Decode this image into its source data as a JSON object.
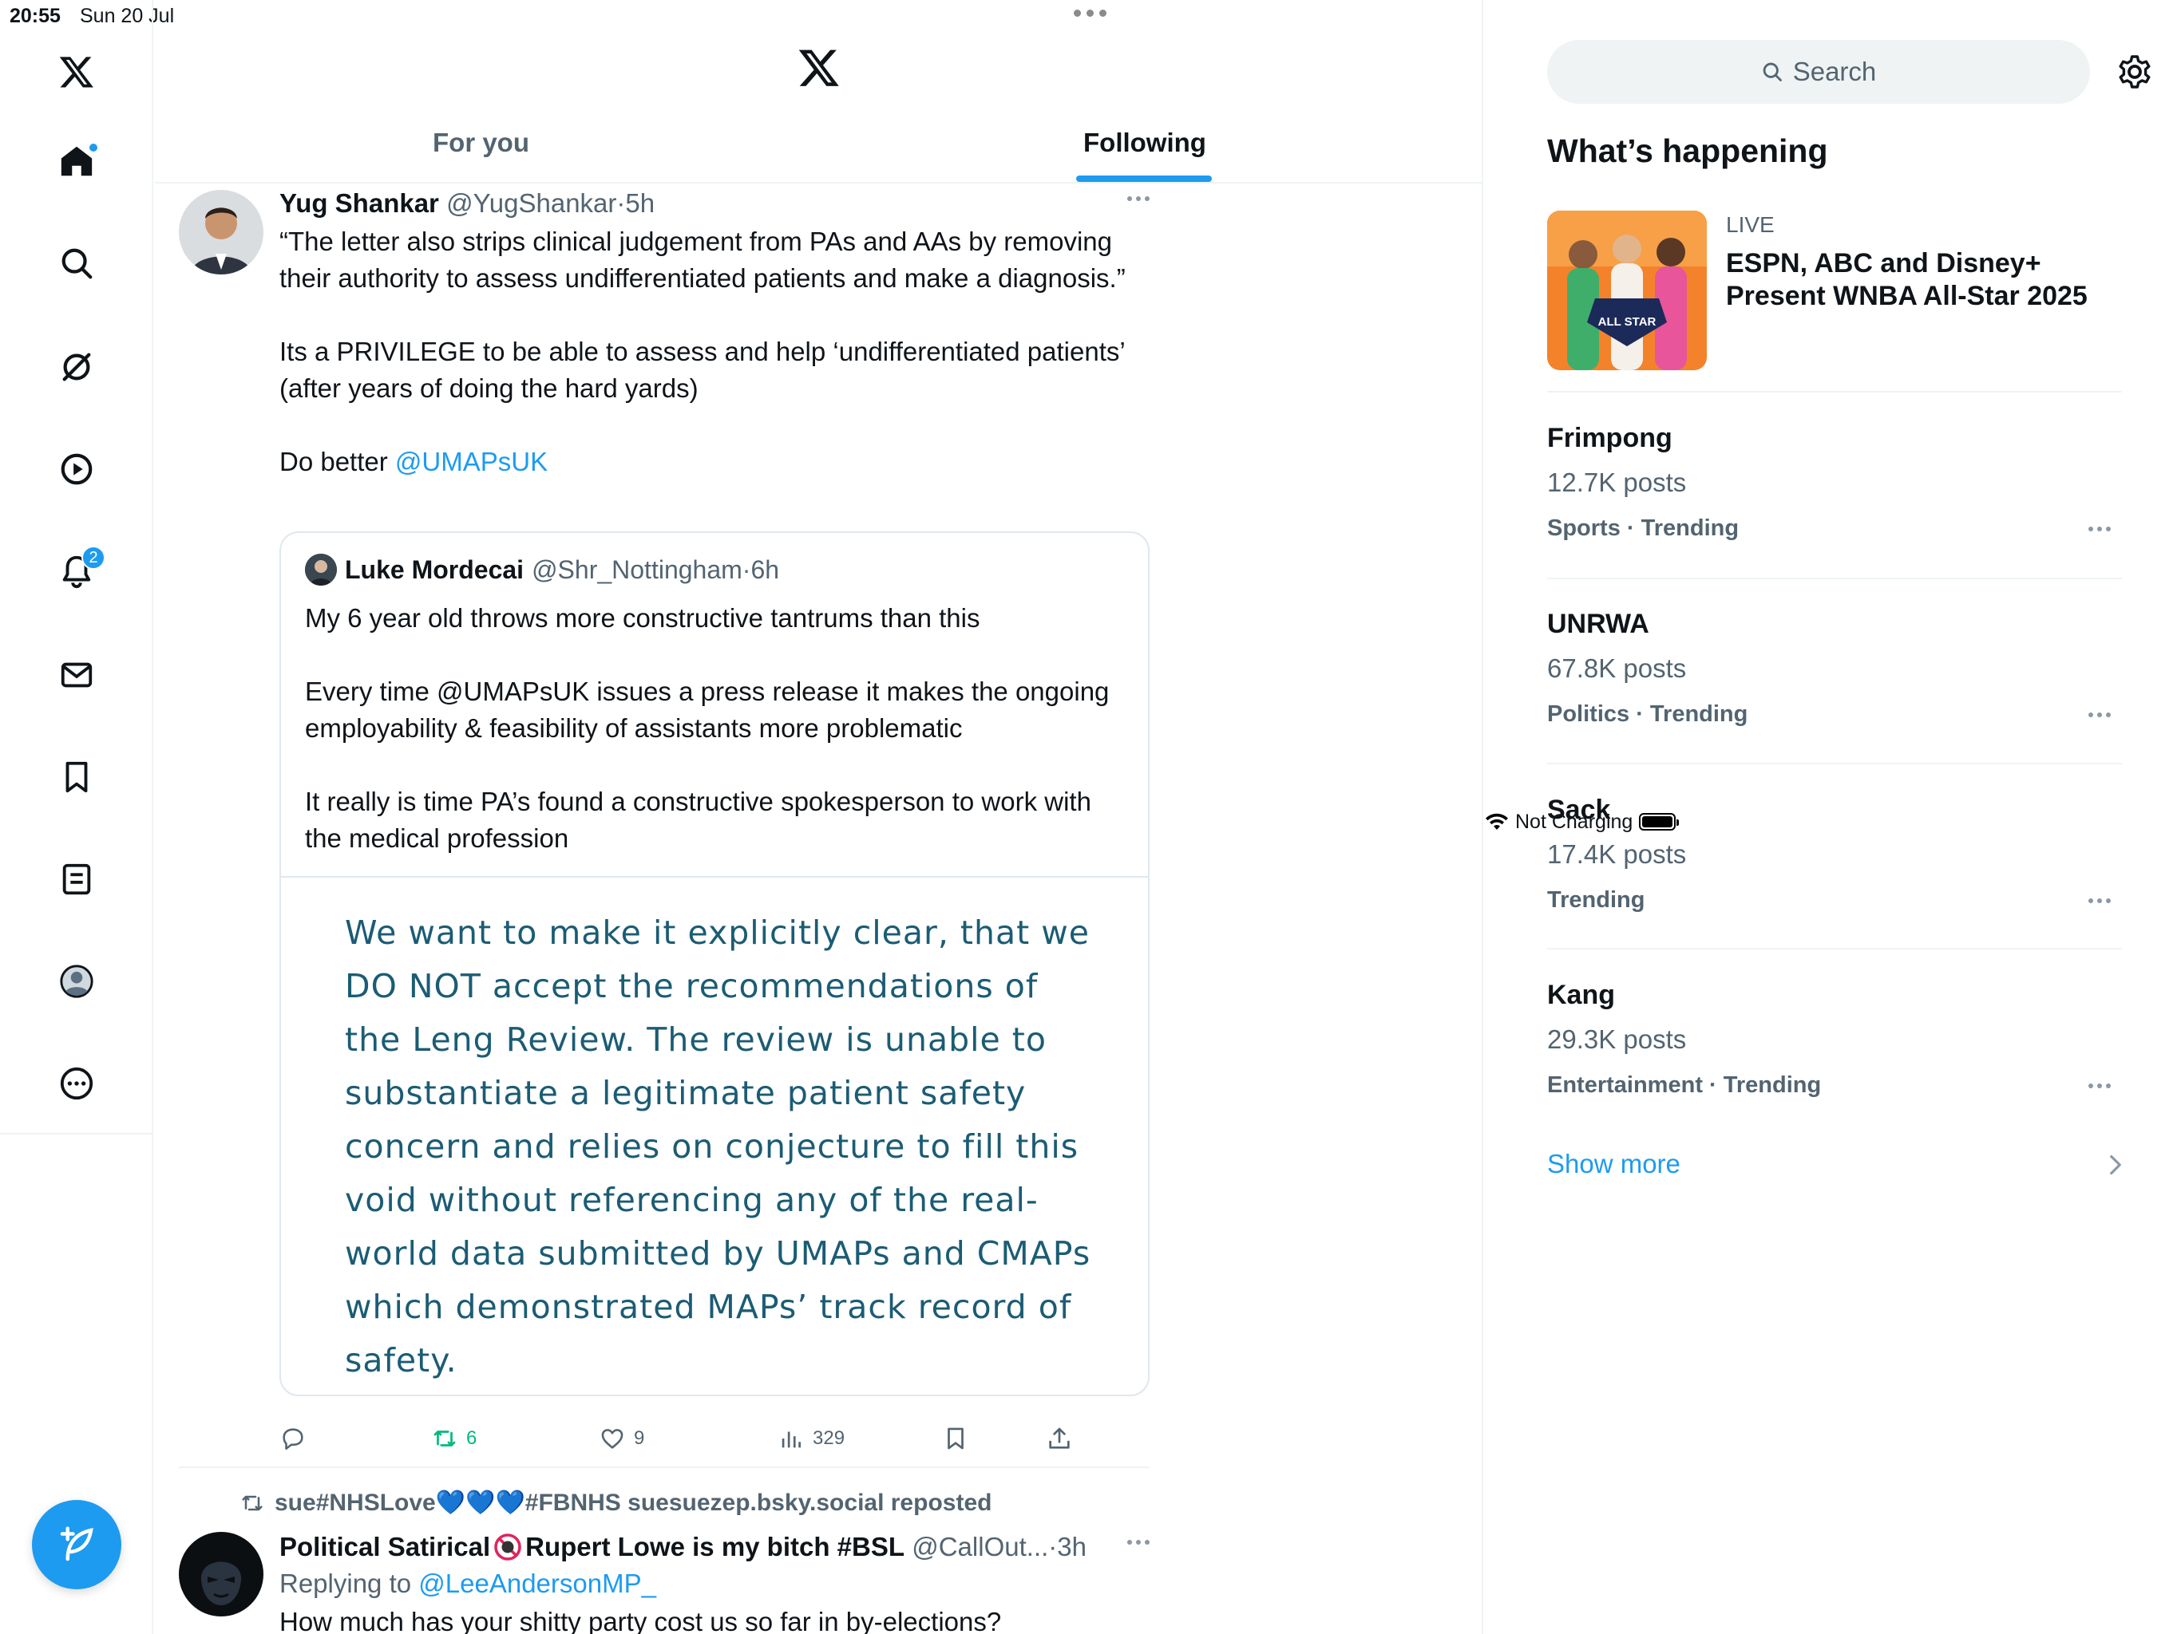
{
  "status_bar": {
    "time": "20:55",
    "date": "Sun 20 Jul",
    "battery_text": "Not Charging"
  },
  "left_nav": {
    "items": [
      {
        "name": "x-logo-icon"
      },
      {
        "name": "home-icon"
      },
      {
        "name": "search-icon"
      },
      {
        "name": "grok-icon"
      },
      {
        "name": "video-icon"
      },
      {
        "name": "notifications-icon",
        "badge": "2"
      },
      {
        "name": "messages-icon"
      },
      {
        "name": "bookmarks-icon"
      },
      {
        "name": "lists-icon"
      },
      {
        "name": "profile-icon"
      },
      {
        "name": "more-icon"
      }
    ],
    "compose_icon": "compose-icon"
  },
  "header": {
    "tabs": [
      {
        "label": "For you",
        "active": false
      },
      {
        "label": "Following",
        "active": true
      }
    ]
  },
  "tweet1": {
    "name": "Yug Shankar",
    "handle": "@YugShankar",
    "sep": "·",
    "time": "5h",
    "text_main": "“The letter also strips clinical judgement from PAs and AAs by removing their authority to assess undifferentiated patients and make a diagnosis.”\n\nIts a PRIVILEGE to be able to assess and help ‘undifferentiated patients’ (after years of doing the hard yards)\n\nDo better ",
    "mention": "@UMAPsUK",
    "quote": {
      "name": "Luke Mordecai",
      "handle": "@Shr_Nottingham",
      "sep": "·",
      "time": "6h",
      "text": "My 6 year old throws more constructive tantrums than this\n\nEvery time @UMAPsUK issues a press release it makes the ongoing employability & feasibility of assistants more problematic\n\nIt really is time PA’s found a constructive spokesperson to work with the medical profession",
      "image_text": "We want to make it explicitly clear, that we DO NOT accept the recommendations of the Leng Review. The review is unable to substantiate a legitimate patient safety concern and relies on conjecture to fill this void without referencing any of the real-world data submitted by UMAPs and CMAPs which demonstrated MAPs’ track record of safety."
    },
    "actions": {
      "reposts": "6",
      "likes": "9",
      "views": "329"
    }
  },
  "tweet2": {
    "repost_by": "sue#NHSLove💙💙💙#FBNHS suesuezep.bsky.social reposted",
    "name_a": "Political Satirical",
    "name_b": "Rupert Lowe is my bitch #BSL",
    "handle": "@CallOut...",
    "sep": "·",
    "time": "3h",
    "replying_label": "Replying to ",
    "replying_to": "@LeeAndersonMP_",
    "text": "How much has your shitty party cost us so far in by-elections?"
  },
  "right": {
    "search_placeholder": "Search",
    "whats_happening": "What’s happening",
    "live_label": "LIVE",
    "live_title": "ESPN, ABC and Disney+ Present WNBA All-Star 2025",
    "live_badge": "ALL STAR",
    "trends": [
      {
        "name": "Frimpong",
        "posts": "12.7K posts",
        "category": "Sports · Trending"
      },
      {
        "name": "UNRWA",
        "posts": "67.8K posts",
        "category": "Politics · Trending"
      },
      {
        "name": "Sack",
        "posts": "17.4K posts",
        "category": "Trending"
      },
      {
        "name": "Kang",
        "posts": "29.3K posts",
        "category": "Entertainment · Trending"
      }
    ],
    "show_more": "Show more"
  },
  "colors": {
    "accent": "#1d9bf0",
    "repost_green": "#00ba7c",
    "muted": "#536471",
    "quote_image_text": "#1b5c74"
  }
}
